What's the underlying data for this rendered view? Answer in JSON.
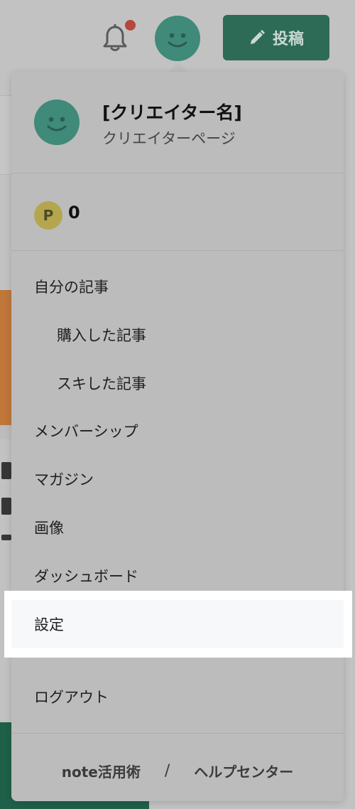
{
  "header": {
    "post_label": "投稿",
    "icons": {
      "notification": "bell-icon",
      "post": "pencil-icon",
      "avatar": "smiley-avatar"
    }
  },
  "colors": {
    "avatar": "#3f8a78",
    "post_button": "#2d6b57",
    "notification_dot": "#b5483a",
    "point_badge": "#b3a64e",
    "highlight": "#ffffff"
  },
  "menu": {
    "creator_name": "[クリエイター名]",
    "creator_page": "クリエイターページ",
    "points_symbol": "P",
    "points_value": "0",
    "items": [
      {
        "label": "自分の記事"
      },
      {
        "label": "購入した記事"
      },
      {
        "label": "スキした記事"
      },
      {
        "label": "メンバーシップ"
      },
      {
        "label": "マガジン"
      },
      {
        "label": "画像"
      },
      {
        "label": "ダッシュボード"
      },
      {
        "label": "設定"
      },
      {
        "label": "ログアウト"
      }
    ],
    "footer": {
      "note_tips": "note活用術",
      "separator": "/",
      "help_center": "ヘルプセンター"
    }
  }
}
